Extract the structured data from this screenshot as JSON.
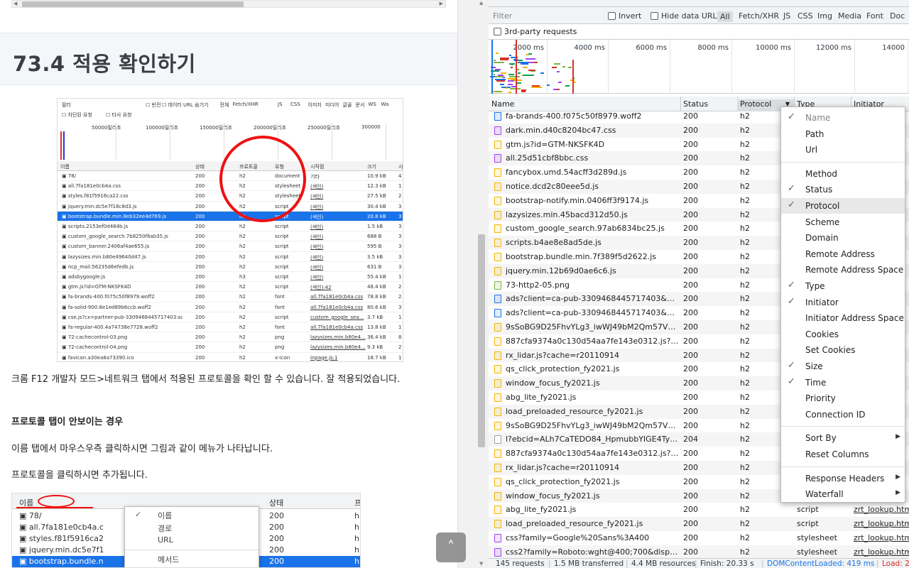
{
  "article": {
    "heading": "73.4 적용 확인하기",
    "para1": "크롬 F12 개발자 모드>네트워크 탭에서 적용된 프로토콜을 확인 할 수 있습니다. 잘 적용되었습니다.",
    "para2": "프로토콜 탭이 안보이는 경우",
    "para3": "이름 탭에서 마우스우측 클릭하시면 그림과 같이 메뉴가 나타납니다.",
    "para4": "프로토콜을 클릭하시면 추가됩니다.",
    "top_button": "˄"
  },
  "shot1": {
    "filter_label": "필터",
    "filter_opts": [
      "반전",
      "데이터 URL 숨기기",
      "전체",
      "Fetch/XHR",
      "JS",
      "CSS",
      "이미지",
      "미디어",
      "글꼴",
      "문서",
      "WS",
      "Wa"
    ],
    "filter_opts2": [
      "차단된 요청",
      "타사 요청"
    ],
    "ticks": [
      "50000밀리초",
      "100000밀리초",
      "150000밀리초",
      "200000밀리초",
      "250000밀리초",
      "300000"
    ],
    "columns": [
      "이름",
      "상태",
      "프로토콜",
      "유형",
      "시작점",
      "크기",
      "시"
    ],
    "rows": [
      [
        "78/",
        "200",
        "h2",
        "document",
        "기타",
        "10.9 kB",
        "4"
      ],
      [
        "all.7fa181e0cb4a.css",
        "200",
        "h2",
        "stylesheet",
        "(색인)",
        "12.3 kB",
        "1"
      ],
      [
        "styles.f81f5916ca22.css",
        "200",
        "h2",
        "stylesheet",
        "(색인)",
        "27.5 kB",
        "2"
      ],
      [
        "jquery.min.dc5e7f18c8d3.js",
        "200",
        "h2",
        "script",
        "(색인)",
        "30.4 kB",
        "3"
      ],
      [
        "bootstrap.bundle.min.8eb32ee4d769.js",
        "200",
        "h2",
        "script",
        "(색인)",
        "20.8 kB",
        "3"
      ],
      [
        "scripts.2153ef0d484b.js",
        "200",
        "h2",
        "script",
        "(색인)",
        "1.5 kB",
        "3"
      ],
      [
        "custom_google_search.7b8250f6ab35.js",
        "200",
        "h2",
        "script",
        "(색인)",
        "688 B",
        "3"
      ],
      [
        "custom_banner.2406af4ae655.js",
        "200",
        "h2",
        "script",
        "(색인)",
        "595 B",
        "3"
      ],
      [
        "lazysizes.min.b80e49640d47.js",
        "200",
        "h2",
        "script",
        "(색인)",
        "3.5 kB",
        "3"
      ],
      [
        "ncp_mail.56235d6efedb.js",
        "200",
        "h2",
        "script",
        "(색인)",
        "631 B",
        "3"
      ],
      [
        "adsbygoogle.js",
        "200",
        "h3",
        "script",
        "(색인)",
        "55.4 kB",
        "1"
      ],
      [
        "gtm.js?id=GTM-NKSFK4D",
        "200",
        "h2",
        "script",
        "(색인):42",
        "48.4 kB",
        "2"
      ],
      [
        "fa-brands-400.f075c50f8979.woff2",
        "200",
        "h2",
        "font",
        "all.7fa181e0cb4a.css",
        "78.8 kB",
        "2"
      ],
      [
        "fa-solid-900.8e1ed89b6ccb.woff2",
        "200",
        "h2",
        "font",
        "all.7fa181e0cb4a.css",
        "80.6 kB",
        "3"
      ],
      [
        "cse.js?cx=partner-pub-3309468445717403:sca...",
        "200",
        "h2",
        "script",
        "custom_google_sea...",
        "3.7 kB",
        "1"
      ],
      [
        "fa-regular-400.4a74738e7728.woff2",
        "200",
        "h2",
        "font",
        "all.7fa181e0cb4a.css",
        "13.8 kB",
        "1"
      ],
      [
        "72-cachecontrol-03.png",
        "200",
        "h2",
        "png",
        "lazysizes.min.b80e4...",
        "36.4 kB",
        "8"
      ],
      [
        "72-cachecontrol-04.png",
        "200",
        "h2",
        "png",
        "lazysizes.min.b80e4...",
        "9.3 kB",
        "2"
      ],
      [
        "favicon.a30ea8a73390.ico",
        "200",
        "h2",
        "x-icon",
        "inpage.js:1",
        "18.7 kB",
        "1"
      ]
    ]
  },
  "shot2": {
    "col1": "이름",
    "col2": "상태",
    "col3": "프",
    "rows": [
      [
        "78/",
        "200",
        "h"
      ],
      [
        "all.7fa181e0cb4a.c",
        "200",
        "h"
      ],
      [
        "styles.f81f5916ca2",
        "200",
        "h"
      ],
      [
        "jquery.min.dc5e7f1",
        "200",
        "h"
      ],
      [
        "bootstrap.bundle.n",
        "200",
        "h"
      ]
    ],
    "menu": [
      "이름",
      "경로",
      "URL",
      "메서드"
    ]
  },
  "devtools": {
    "filter_placeholder": "Filter",
    "invert": "Invert",
    "hide_data_urls": "Hide data URLs",
    "types": [
      "All",
      "Fetch/XHR",
      "JS",
      "CSS",
      "Img",
      "Media",
      "Font",
      "Doc"
    ],
    "third_party": "3rd-party requests",
    "ticks": [
      "2000 ms",
      "4000 ms",
      "6000 ms",
      "8000 ms",
      "10000 ms",
      "12000 ms",
      "14000"
    ],
    "columns": [
      "Name",
      "Status",
      "Protocol",
      "Type",
      "Initiator"
    ],
    "rows": [
      {
        "name": "fa-brands-400.f075c50f8979.woff2",
        "status": "200",
        "protocol": "h2",
        "type": "",
        "initiator": "",
        "kind": "font"
      },
      {
        "name": "dark.min.d40c8204bc47.css",
        "status": "200",
        "protocol": "h2",
        "type": "",
        "initiator": "",
        "kind": "css"
      },
      {
        "name": "gtm.js?id=GTM-NKSFK4D",
        "status": "200",
        "protocol": "h2",
        "type": "",
        "initiator": "",
        "kind": "js"
      },
      {
        "name": "all.25d51cbf8bbc.css",
        "status": "200",
        "protocol": "h2",
        "type": "",
        "initiator": "",
        "kind": "css"
      },
      {
        "name": "fancybox.umd.54acff3d289d.js",
        "status": "200",
        "protocol": "h2",
        "type": "",
        "initiator": "",
        "kind": "js"
      },
      {
        "name": "notice.dcd2c80eee5d.js",
        "status": "200",
        "protocol": "h2",
        "type": "",
        "initiator": "",
        "kind": "js"
      },
      {
        "name": "bootstrap-notify.min.0406ff3f9174.js",
        "status": "200",
        "protocol": "h2",
        "type": "",
        "initiator": "",
        "kind": "js"
      },
      {
        "name": "lazysizes.min.45bacd312d50.js",
        "status": "200",
        "protocol": "h2",
        "type": "",
        "initiator": "",
        "kind": "js"
      },
      {
        "name": "custom_google_search.97ab6834bc25.js",
        "status": "200",
        "protocol": "h2",
        "type": "",
        "initiator": "",
        "kind": "js"
      },
      {
        "name": "scripts.b4ae8e8ad5de.js",
        "status": "200",
        "protocol": "h2",
        "type": "",
        "initiator": "",
        "kind": "js"
      },
      {
        "name": "bootstrap.bundle.min.7f389f5d2622.js",
        "status": "200",
        "protocol": "h2",
        "type": "",
        "initiator": "",
        "kind": "js"
      },
      {
        "name": "jquery.min.12b69d0ae6c6.js",
        "status": "200",
        "protocol": "h2",
        "type": "",
        "initiator": "",
        "kind": "js"
      },
      {
        "name": "73-http2-05.png",
        "status": "200",
        "protocol": "h2",
        "type": "",
        "initiator": "",
        "kind": "img"
      },
      {
        "name": "ads?client=ca-pub-3309468445717403&outp...",
        "status": "200",
        "protocol": "h2",
        "type": "",
        "initiator": "",
        "kind": "doc"
      },
      {
        "name": "ads?client=ca-pub-3309468445717403&outp...",
        "status": "200",
        "protocol": "h2",
        "type": "",
        "initiator": "",
        "kind": "doc"
      },
      {
        "name": "9sSoBG9D25FhvYLg3_iwWJ49bM2Qm57VxEM...",
        "status": "200",
        "protocol": "h2",
        "type": "",
        "initiator": "",
        "kind": "js"
      },
      {
        "name": "887cfa9374a0c130d54aa7fe143e0312.js?tag=...",
        "status": "200",
        "protocol": "h2",
        "type": "",
        "initiator": "",
        "kind": "js"
      },
      {
        "name": "rx_lidar.js?cache=r20110914",
        "status": "200",
        "protocol": "h2",
        "type": "",
        "initiator": "",
        "kind": "js"
      },
      {
        "name": "qs_click_protection_fy2021.js",
        "status": "200",
        "protocol": "h2",
        "type": "",
        "initiator": "",
        "kind": "js"
      },
      {
        "name": "window_focus_fy2021.js",
        "status": "200",
        "protocol": "h2",
        "type": "",
        "initiator": "",
        "kind": "js"
      },
      {
        "name": "abg_lite_fy2021.js",
        "status": "200",
        "protocol": "h2",
        "type": "",
        "initiator": "",
        "kind": "js"
      },
      {
        "name": "load_preloaded_resource_fy2021.js",
        "status": "200",
        "protocol": "h2",
        "type": "",
        "initiator": "",
        "kind": "js"
      },
      {
        "name": "9sSoBG9D25FhvYLg3_iwWJ49bM2Qm57VxEM...",
        "status": "200",
        "protocol": "h2",
        "type": "",
        "initiator": "",
        "kind": "js"
      },
      {
        "name": "l?ebcid=ALh7CaTEDO84_HpmubbYIGE4TyeUd...",
        "status": "204",
        "protocol": "h2",
        "type": "",
        "initiator": "",
        "kind": "blank"
      },
      {
        "name": "887cfa9374a0c130d54aa7fe143e0312.js?tag=...",
        "status": "200",
        "protocol": "h2",
        "type": "",
        "initiator": "",
        "kind": "js"
      },
      {
        "name": "rx_lidar.js?cache=r20110914",
        "status": "200",
        "protocol": "h2",
        "type": "",
        "initiator": "",
        "kind": "js"
      },
      {
        "name": "qs_click_protection_fy2021.js",
        "status": "200",
        "protocol": "h2",
        "type": "",
        "initiator": "",
        "kind": "js"
      },
      {
        "name": "window_focus_fy2021.js",
        "status": "200",
        "protocol": "h2",
        "type": "",
        "initiator": "",
        "kind": "js"
      },
      {
        "name": "abg_lite_fy2021.js",
        "status": "200",
        "protocol": "h2",
        "type": "script",
        "initiator": "zrt_lookup.html",
        "kind": "js"
      },
      {
        "name": "load_preloaded_resource_fy2021.js",
        "status": "200",
        "protocol": "h2",
        "type": "script",
        "initiator": "zrt_lookup.html",
        "kind": "js"
      },
      {
        "name": "css?family=Google%20Sans%3A400",
        "status": "200",
        "protocol": "h2",
        "type": "stylesheet",
        "initiator": "zrt_lookup.html",
        "kind": "css"
      },
      {
        "name": "css2?family=Roboto:wght@400;700&display=...",
        "status": "200",
        "protocol": "h2",
        "type": "stylesheet",
        "initiator": "zrt_lookup.html",
        "kind": "css"
      }
    ],
    "status_bar": [
      "145 requests",
      "1.5 MB transferred",
      "4.4 MB resources",
      "Finish: 20.33 s",
      "DOMContentLoaded: 419 ms",
      "Load: 2"
    ],
    "kind_colors": {
      "js": "#f4b400",
      "css": "#a142f4",
      "font": "#1a73e8",
      "img": "#7cb342",
      "doc": "#1a73e8",
      "blank": "#9aa0a6"
    },
    "domcontent_color": "#1a73e8",
    "load_color": "#d93025"
  },
  "menu": {
    "items": [
      {
        "label": "Name",
        "checked": true,
        "disabled": true
      },
      {
        "label": "Path",
        "checked": false
      },
      {
        "label": "Url",
        "checked": false
      },
      {
        "sep": true
      },
      {
        "label": "Method",
        "checked": false
      },
      {
        "label": "Status",
        "checked": true
      },
      {
        "label": "Protocol",
        "checked": true,
        "hover": true
      },
      {
        "label": "Scheme",
        "checked": false
      },
      {
        "label": "Domain",
        "checked": false
      },
      {
        "label": "Remote Address",
        "checked": false
      },
      {
        "label": "Remote Address Space",
        "checked": false
      },
      {
        "label": "Type",
        "checked": true
      },
      {
        "label": "Initiator",
        "checked": true
      },
      {
        "label": "Initiator Address Space",
        "checked": false
      },
      {
        "label": "Cookies",
        "checked": false
      },
      {
        "label": "Set Cookies",
        "checked": false
      },
      {
        "label": "Size",
        "checked": true
      },
      {
        "label": "Time",
        "checked": true
      },
      {
        "label": "Priority",
        "checked": false
      },
      {
        "label": "Connection ID",
        "checked": false
      },
      {
        "sep": true
      },
      {
        "label": "Sort By",
        "checked": false,
        "submenu": true
      },
      {
        "label": "Reset Columns",
        "checked": false
      },
      {
        "sep": true
      },
      {
        "label": "Response Headers",
        "checked": false,
        "submenu": true
      },
      {
        "label": "Waterfall",
        "checked": false,
        "submenu": true
      }
    ]
  }
}
